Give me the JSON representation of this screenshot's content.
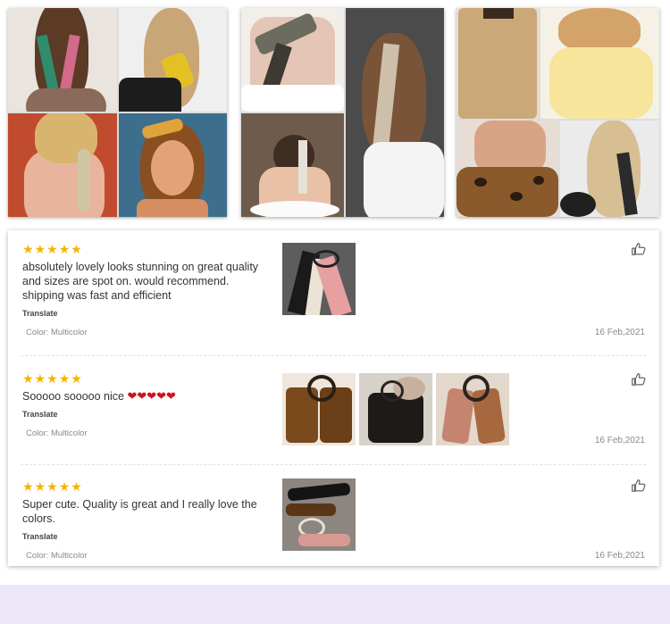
{
  "gallery": {
    "collages": [
      {
        "name": "collage-left",
        "description_icon": "photo-icon"
      },
      {
        "name": "collage-middle",
        "description_icon": "photo-icon"
      },
      {
        "name": "collage-right",
        "description_icon": "photo-icon"
      }
    ]
  },
  "reviews": [
    {
      "stars": 5,
      "text": "absolutely lovely looks stunning on great quality and sizes are spot on. would recommend. shipping was fast and efficient",
      "translate_label": "Translate",
      "color": "Color: Multicolor",
      "date": "16 Feb,2021",
      "photo_count": 1,
      "icon": "thumbs-up-icon"
    },
    {
      "stars": 5,
      "text": "Sooooo sooooo nice",
      "emoji": "❤❤❤❤❤",
      "translate_label": "Translate",
      "color": "Color: Multicolor",
      "date": "16 Feb,2021",
      "photo_count": 3,
      "icon": "thumbs-up-icon"
    },
    {
      "stars": 5,
      "text": "Super cute. Quality is great and I really love the colors.",
      "translate_label": "Translate",
      "color": "Color: Multicolor",
      "date": "16 Feb,2021",
      "photo_count": 1,
      "icon": "thumbs-up-icon"
    }
  ],
  "colors": {
    "star": "#f5b400",
    "heart": "#d0121b",
    "footer_band": "#ece6f7"
  }
}
